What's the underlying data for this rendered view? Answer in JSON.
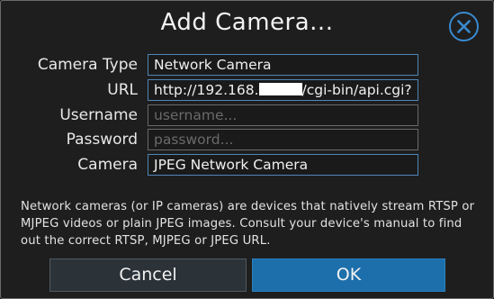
{
  "dialog": {
    "title": "Add Camera...",
    "close_icon": "close-circle-icon"
  },
  "form": {
    "camera_type": {
      "label": "Camera Type",
      "value": "Network Camera"
    },
    "url": {
      "label": "URL",
      "value_prefix": "http://192.168.",
      "value_suffix": "/cgi-bin/api.cgi?"
    },
    "username": {
      "label": "Username",
      "placeholder": "username..."
    },
    "password": {
      "label": "Password",
      "placeholder": "password..."
    },
    "camera": {
      "label": "Camera",
      "value": "JPEG Network Camera"
    }
  },
  "description": "Network cameras (or IP cameras) are devices that natively stream RTSP or MJPEG videos or plain JPEG images. Consult your device's manual to find out the correct RTSP, MJPEG or JPEG URL.",
  "buttons": {
    "cancel": "Cancel",
    "ok": "OK"
  },
  "colors": {
    "accent": "#1c6fab",
    "field_border": "#4f86b8",
    "background": "#1e1e1e"
  }
}
